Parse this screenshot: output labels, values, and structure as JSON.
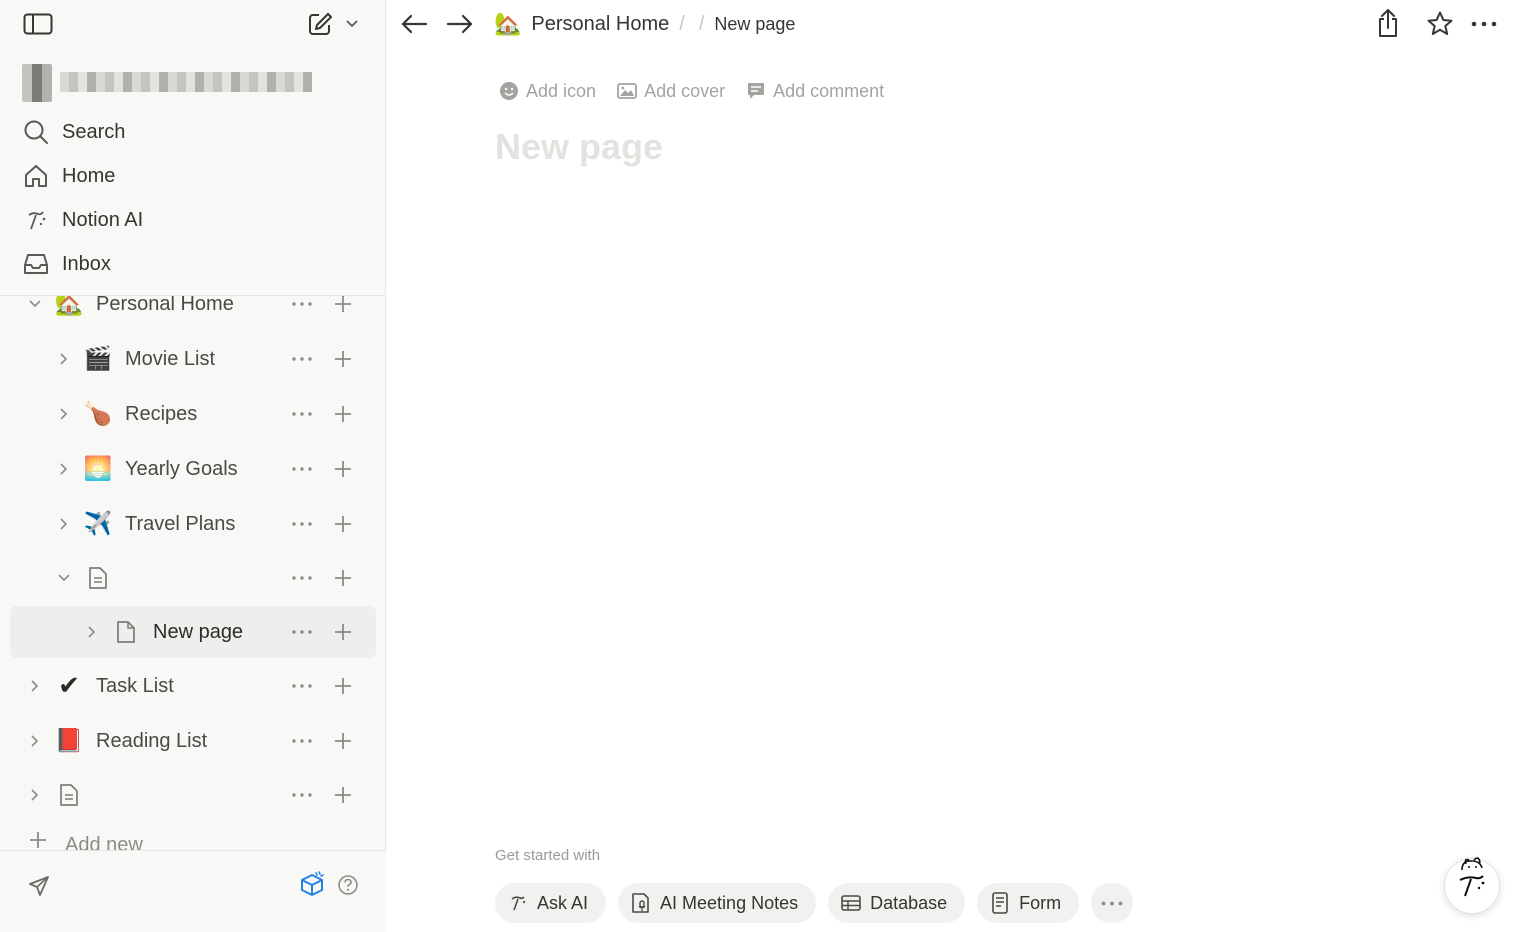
{
  "sidebar": {
    "workspace_name": "",
    "nav": [
      {
        "label": "Search",
        "icon": "search-icon"
      },
      {
        "label": "Home",
        "icon": "home-icon"
      },
      {
        "label": "Notion AI",
        "icon": "notion-ai-icon"
      },
      {
        "label": "Inbox",
        "icon": "inbox-icon"
      }
    ],
    "tree": [
      {
        "label": "Personal Home",
        "emoji": "🏡",
        "expanded": true
      },
      {
        "label": "Movie List",
        "emoji": "🎬",
        "expanded": false
      },
      {
        "label": "Recipes",
        "emoji": "🍗",
        "expanded": false
      },
      {
        "label": "Yearly Goals",
        "emoji": "🌅",
        "expanded": false
      },
      {
        "label": "Travel Plans",
        "emoji": "✈️",
        "expanded": false
      },
      {
        "label": "",
        "icon": "page-icon",
        "expanded": true
      },
      {
        "label": "New page",
        "icon": "page-icon",
        "expanded": false,
        "selected": true
      },
      {
        "label": "Task List",
        "emoji": "✔",
        "expanded": false
      },
      {
        "label": "Reading List",
        "emoji": "📕",
        "expanded": false
      },
      {
        "label": "",
        "icon": "page-icon",
        "expanded": false
      }
    ],
    "add_new_label": "Add new"
  },
  "topbar": {
    "breadcrumb": [
      {
        "label": "Personal Home",
        "emoji": "🏡"
      },
      {
        "label": "New page"
      }
    ]
  },
  "page": {
    "actions": {
      "add_icon": "Add icon",
      "add_cover": "Add cover",
      "add_comment": "Add comment"
    },
    "title_placeholder": "New page",
    "get_started_label": "Get started with",
    "quick_actions": [
      {
        "label": "Ask AI",
        "icon": "notion-ai-icon"
      },
      {
        "label": "AI Meeting Notes",
        "icon": "meeting-notes-icon"
      },
      {
        "label": "Database",
        "icon": "table-icon"
      },
      {
        "label": "Form",
        "icon": "form-icon"
      }
    ]
  },
  "colors": {
    "sidebar_bg": "#f8f8f7",
    "selected_row_bg": "#eeeeec",
    "accent_blue": "#2383e2",
    "muted_text": "#a5a39e"
  }
}
